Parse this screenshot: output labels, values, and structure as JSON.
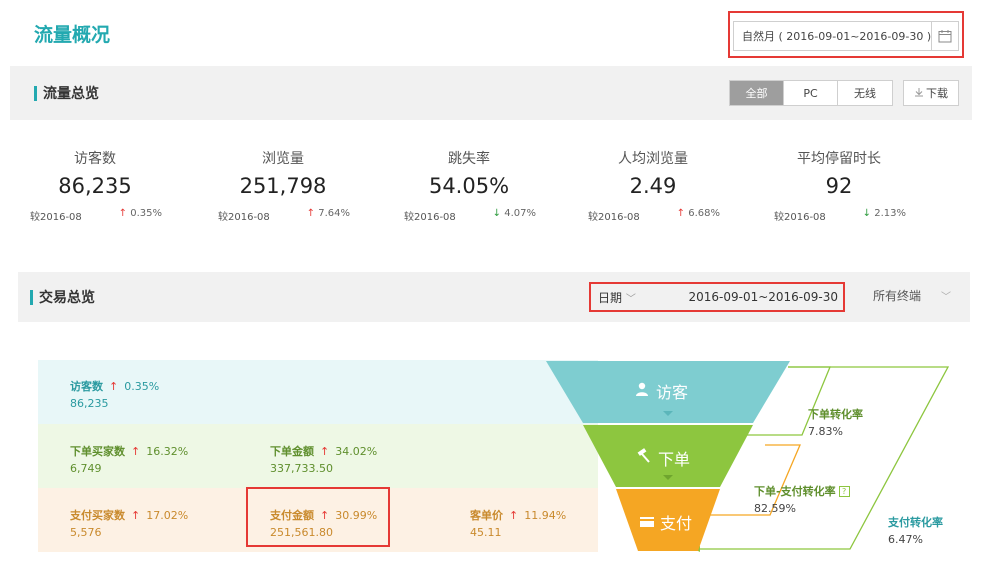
{
  "header": {
    "title": "流量概况",
    "date_range": "自然月 ( 2016-09-01~2016-09-30 )"
  },
  "traffic": {
    "title": "流量总览",
    "segments": [
      {
        "label": "全部",
        "active": true
      },
      {
        "label": "PC",
        "active": false
      },
      {
        "label": "无线",
        "active": false
      }
    ],
    "download_label": "下载",
    "metrics": [
      {
        "label": "访客数",
        "value": "86,235",
        "compare": "较2016-08",
        "change": "0.35%",
        "direction": "up"
      },
      {
        "label": "浏览量",
        "value": "251,798",
        "compare": "较2016-08",
        "change": "7.64%",
        "direction": "up"
      },
      {
        "label": "跳失率",
        "value": "54.05%",
        "compare": "较2016-08",
        "change": "4.07%",
        "direction": "down"
      },
      {
        "label": "人均浏览量",
        "value": "2.49",
        "compare": "较2016-08",
        "change": "6.68%",
        "direction": "up"
      },
      {
        "label": "平均停留时长",
        "value": "92",
        "compare": "较2016-08",
        "change": "2.13%",
        "direction": "down"
      }
    ]
  },
  "trade": {
    "title": "交易总览",
    "date_label": "日期",
    "date_value": "2016-09-01~2016-09-30",
    "terminal_label": "所有终端",
    "rows": {
      "visitors": {
        "name": "访客数",
        "rate": "0.35%",
        "value": "86,235"
      },
      "order_buyers": {
        "name": "下单买家数",
        "rate": "16.32%",
        "value": "6,749"
      },
      "order_amount": {
        "name": "下单金额",
        "rate": "34.02%",
        "value": "337,733.50"
      },
      "pay_buyers": {
        "name": "支付买家数",
        "rate": "17.02%",
        "value": "5,576"
      },
      "pay_amount": {
        "name": "支付金额",
        "rate": "30.99%",
        "value": "251,561.80"
      },
      "unit_price": {
        "name": "客单价",
        "rate": "11.94%",
        "value": "45.11"
      }
    },
    "funnel": {
      "visit": "访客",
      "order": "下单",
      "pay": "支付"
    },
    "conversions": {
      "order_rate": {
        "name": "下单转化率",
        "value": "7.83%"
      },
      "order_pay_rate": {
        "name": "下单-支付转化率",
        "value": "82.59%"
      },
      "pay_rate": {
        "name": "支付转化率",
        "value": "6.47%"
      }
    }
  },
  "colors": {
    "accent": "#23a9b0",
    "funnel_visit": "#7ecdd0",
    "funnel_order": "#8dc63f",
    "funnel_pay": "#f5a623",
    "up": "#e53935",
    "down": "#2e9b3e"
  }
}
